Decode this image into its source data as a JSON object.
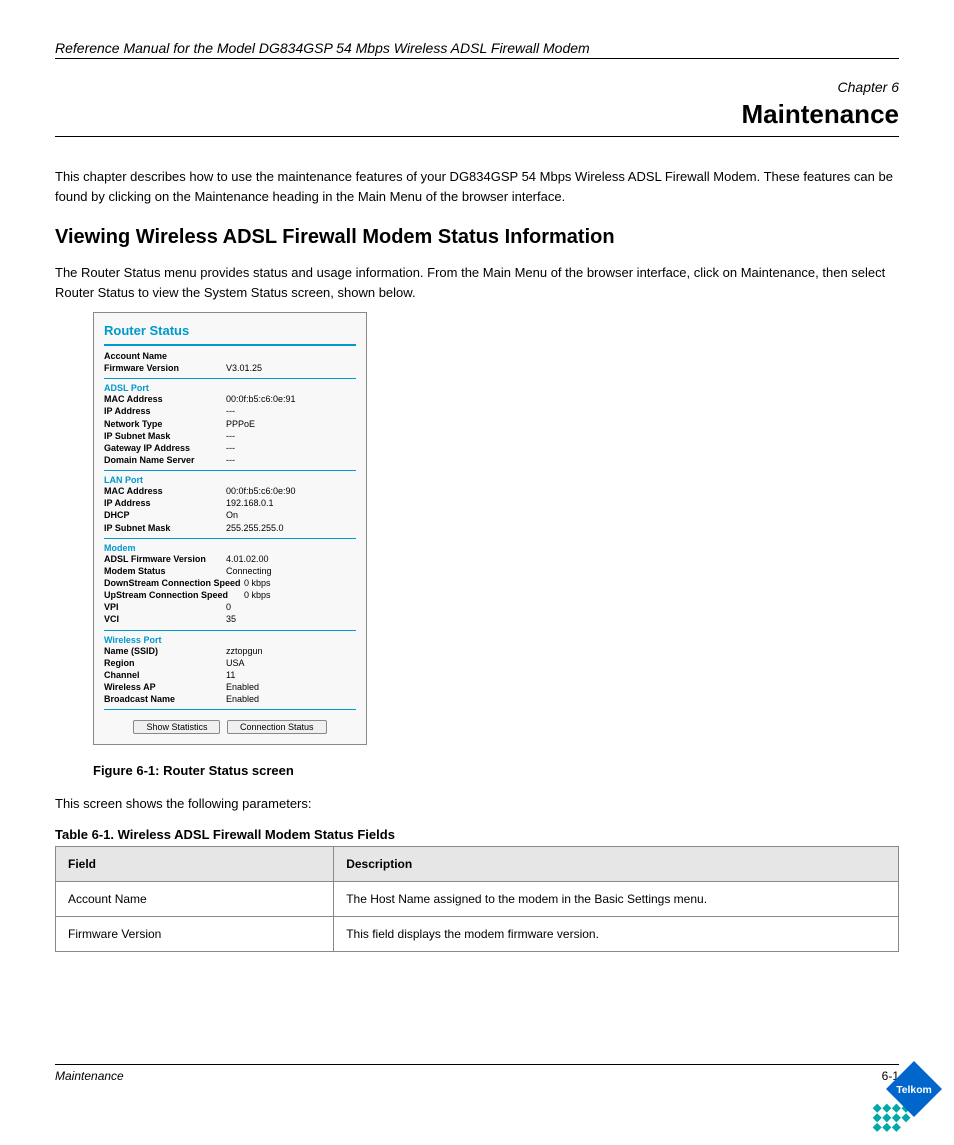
{
  "header": {
    "title": "Reference Manual for the Model DG834GSP 54 Mbps Wireless ADSL Firewall Modem"
  },
  "chapter": {
    "label": "Chapter 6",
    "title": "Maintenance"
  },
  "intro": "This chapter describes how to use the maintenance features of your DG834GSP 54 Mbps Wireless ADSL Firewall Modem. These features can be found by clicking on the Maintenance heading in the Main Menu of the browser interface.",
  "section": {
    "heading": "Viewing Wireless ADSL Firewall Modem Status Information",
    "desc": "The Router Status menu provides status and usage information. From the Main Menu of the browser interface, click on Maintenance, then select Router Status to view the System Status screen, shown below."
  },
  "router_status": {
    "title": "Router Status",
    "account": {
      "labels": {
        "account_name": "Account Name",
        "firmware_version": "Firmware Version"
      },
      "values": {
        "account_name": "",
        "firmware_version": "V3.01.25"
      }
    },
    "adsl_port": {
      "heading": "ADSL Port",
      "labels": {
        "mac": "MAC Address",
        "ip": "IP Address",
        "net_type": "Network Type",
        "subnet": "IP Subnet Mask",
        "gateway": "Gateway IP Address",
        "dns": "Domain Name Server"
      },
      "values": {
        "mac": "00:0f:b5:c6:0e:91",
        "ip": "---",
        "net_type": "PPPoE",
        "subnet": "---",
        "gateway": "---",
        "dns": "---"
      }
    },
    "lan_port": {
      "heading": "LAN Port",
      "labels": {
        "mac": "MAC Address",
        "ip": "IP Address",
        "dhcp": "DHCP",
        "subnet": "IP Subnet Mask"
      },
      "values": {
        "mac": "00:0f:b5:c6:0e:90",
        "ip": "192.168.0.1",
        "dhcp": "On",
        "subnet": "255.255.255.0"
      }
    },
    "modem": {
      "heading": "Modem",
      "labels": {
        "adsl_fw": "ADSL Firmware Version",
        "status": "Modem Status",
        "down": "DownStream Connection Speed",
        "up": "UpStream Connection Speed",
        "vpi": "VPI",
        "vci": "VCI"
      },
      "values": {
        "adsl_fw": "4.01.02.00",
        "status": "Connecting",
        "down": "0 kbps",
        "up": "0 kbps",
        "vpi": "0",
        "vci": "35"
      }
    },
    "wireless": {
      "heading": "Wireless Port",
      "labels": {
        "ssid": "Name (SSID)",
        "region": "Region",
        "channel": "Channel",
        "ap": "Wireless AP",
        "broadcast": "Broadcast Name"
      },
      "values": {
        "ssid": "zztopgun",
        "region": "USA",
        "channel": "11",
        "ap": "Enabled",
        "broadcast": "Enabled"
      }
    },
    "buttons": {
      "stats": "Show Statistics",
      "conn": "Connection Status"
    }
  },
  "figure": {
    "caption": "Figure 6-1:  Router Status screen"
  },
  "desc_line": "This screen shows the following parameters:",
  "table": {
    "caption": "Table 6-1.",
    "caption2": "Wireless ADSL Firewall Modem Status Fields",
    "head": {
      "field": "Field",
      "description": "Description"
    },
    "rows": [
      {
        "field": "Account Name",
        "description": "The Host Name assigned to the modem in the Basic Settings menu."
      },
      {
        "field": "Firmware Version",
        "description": "This field displays the modem firmware version."
      }
    ]
  },
  "footer": {
    "left": "Maintenance",
    "right": "6-1"
  }
}
